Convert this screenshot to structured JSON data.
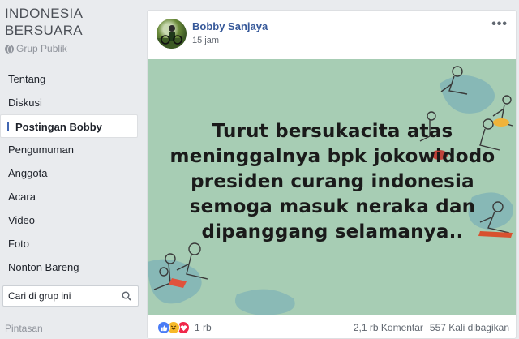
{
  "group": {
    "name": "INDONESIA\nBERSUARA",
    "type_label": "Grup Publik"
  },
  "nav": {
    "items": [
      {
        "label": "Tentang"
      },
      {
        "label": "Diskusi"
      },
      {
        "label": "Postingan Bobby",
        "active": true
      },
      {
        "label": "Pengumuman"
      },
      {
        "label": "Anggota"
      },
      {
        "label": "Acara"
      },
      {
        "label": "Video"
      },
      {
        "label": "Foto"
      },
      {
        "label": "Nonton Bareng"
      }
    ]
  },
  "search": {
    "placeholder": "Cari di grup ini"
  },
  "shortcuts_label": "Pintasan",
  "post": {
    "author": "Bobby Sanjaya",
    "time": "15 jam",
    "more": "•••",
    "image_text": "Turut bersukacita atas\nmeninggalnya bpk jokowidodo\npresiden curang indonesia\nsemoga masuk neraka dan\ndipanggang selamanya..",
    "reaction_count": "1 rb",
    "comments": "2,1 rb Komentar",
    "shares": "557 Kali dibagikan"
  },
  "colors": {
    "link_blue": "#365899",
    "image_bg": "#a7cdb4",
    "page_bg": "#e9ebee"
  },
  "icons": [
    "globe-icon",
    "search-icon",
    "like-icon",
    "haha-icon",
    "love-icon",
    "more-icon"
  ]
}
